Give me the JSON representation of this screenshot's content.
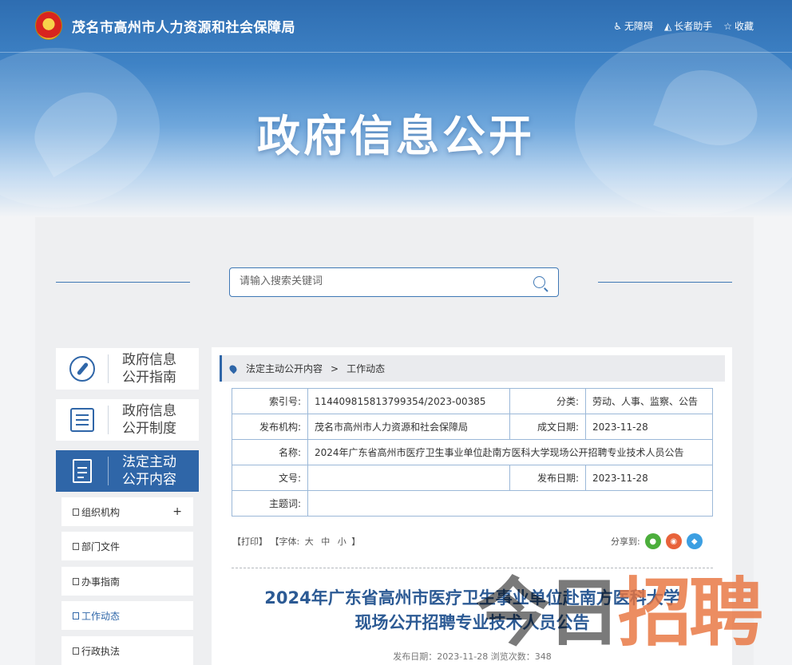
{
  "header": {
    "site_title": "茂名市高州市人力资源和社会保障局",
    "tools": [
      {
        "icon": "wheelchair-icon",
        "label": "无障碍"
      },
      {
        "icon": "elder-icon",
        "label": "长者助手"
      },
      {
        "icon": "star-icon",
        "label": "收藏"
      }
    ],
    "hero_title": "政府信息公开"
  },
  "search": {
    "placeholder": "请输入搜索关键词"
  },
  "left_nav": {
    "big": [
      {
        "line1": "政府信息",
        "line2": "公开指南",
        "icon": "compass-icon"
      },
      {
        "line1": "政府信息",
        "line2": "公开制度",
        "icon": "list-icon"
      },
      {
        "line1": "法定主动",
        "line2": "公开内容",
        "icon": "document-icon"
      }
    ],
    "sub": [
      {
        "label": "组织机构",
        "has_plus": "+"
      },
      {
        "label": "部门文件"
      },
      {
        "label": "办事指南"
      },
      {
        "label": "工作动态"
      },
      {
        "label": "行政执法"
      }
    ]
  },
  "breadcrumb": {
    "first": "法定主动公开内容",
    "sep": ">",
    "second": "工作动态"
  },
  "meta": {
    "index_label": "索引号:",
    "index_value": "114409815813799354/2023-00385",
    "category_label": "分类:",
    "category_value": "劳动、人事、监察、公告",
    "publisher_label": "发布机构:",
    "publisher_value": "茂名市高州市人力资源和社会保障局",
    "written_label": "成文日期:",
    "written_value": "2023-11-28",
    "name_label": "名称:",
    "name_value": "2024年广东省高州市医疗卫生事业单位赴南方医科大学现场公开招聘专业技术人员公告",
    "docno_label": "文号:",
    "docno_value": "",
    "pubdate_label": "发布日期:",
    "pubdate_value": "2023-11-28",
    "subject_label": "主题词:",
    "subject_value": ""
  },
  "article_tools": {
    "print": "【打印】",
    "font_open": "【字体:",
    "big": "大",
    "mid": "中",
    "small": "小",
    "font_close": "】"
  },
  "share": {
    "label": "分享到:"
  },
  "article": {
    "title_line1": "2024年广东省高州市医疗卫生事业单位赴南方医科大学",
    "title_line2": "现场公开招聘专业技术人员公告",
    "date_line": "发布日期：2023-11-28 浏览次数：348"
  },
  "watermark": {
    "gray": "今日",
    "orange": "招聘"
  },
  "colors": {
    "primary": "#2f66a8",
    "title": "#2c5a94"
  }
}
